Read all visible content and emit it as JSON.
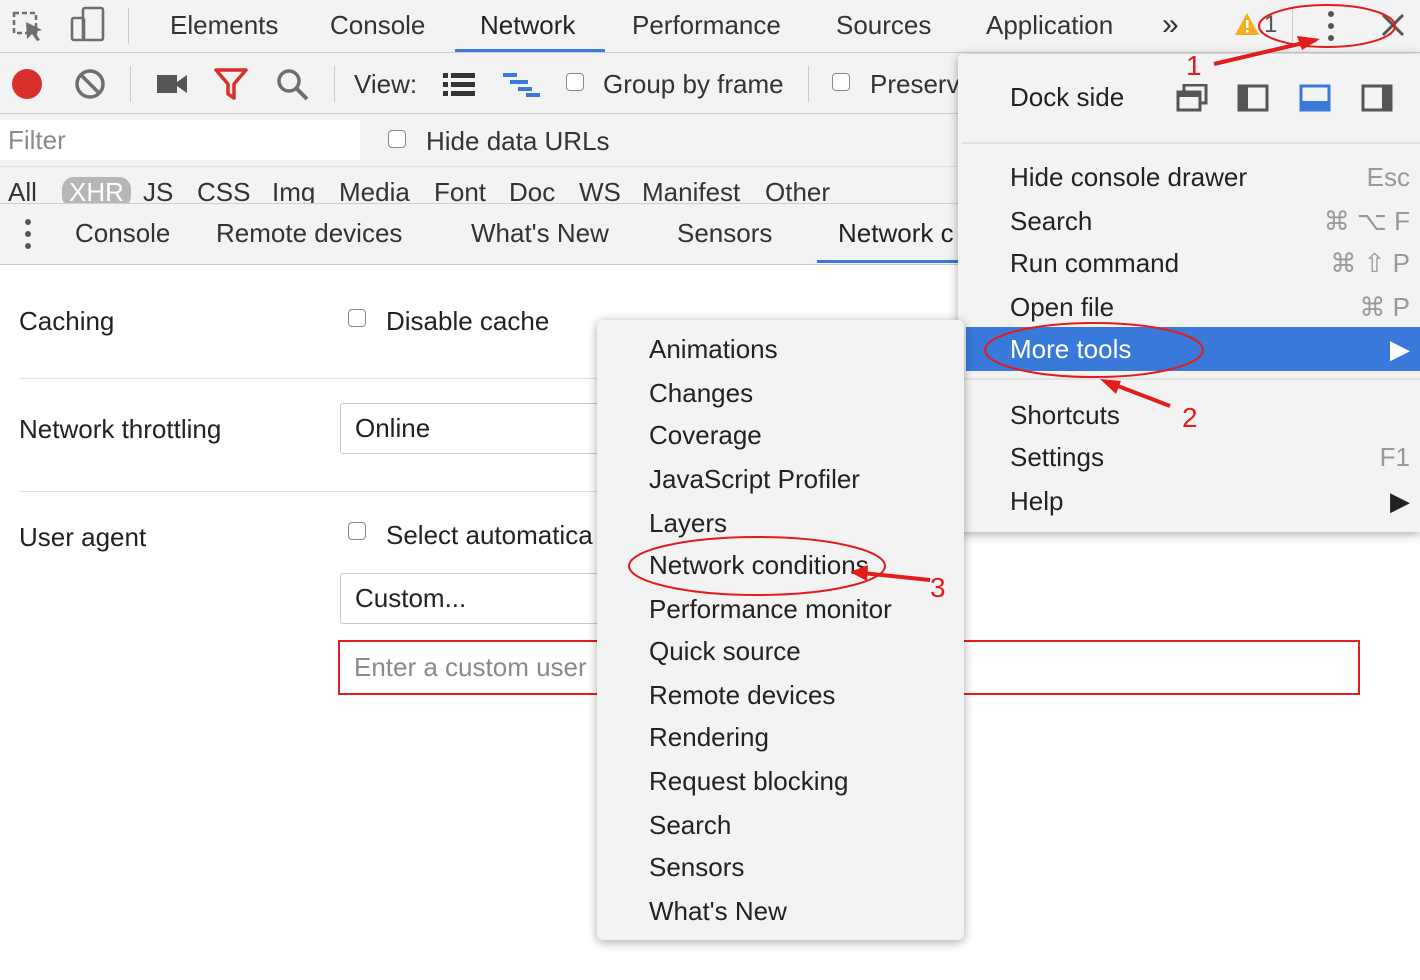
{
  "top_tabs": [
    "Elements",
    "Console",
    "Network",
    "Performance",
    "Sources",
    "Application"
  ],
  "top_overflow": "»",
  "warning_count": "1",
  "toolbar": {
    "view_label": "View:",
    "group_by_frame": "Group by frame",
    "preserve_log": "Preserv"
  },
  "filter": {
    "placeholder": "Filter",
    "hide_data_urls": "Hide data URLs"
  },
  "type_filters": [
    "All",
    "XHR",
    "JS",
    "CSS",
    "Img",
    "Media",
    "Font",
    "Doc",
    "WS",
    "Manifest",
    "Other"
  ],
  "drawer_tabs": [
    "Console",
    "Remote devices",
    "What's New",
    "Sensors",
    "Network c"
  ],
  "panel": {
    "caching_label": "Caching",
    "disable_cache": "Disable cache",
    "throttling_label": "Network throttling",
    "throttling_value": "Online",
    "user_agent_label": "User agent",
    "select_automatically": "Select automatica",
    "ua_select_value": "Custom...",
    "ua_input_placeholder": "Enter a custom user"
  },
  "main_menu": {
    "dock_side": "Dock side",
    "items": [
      {
        "label": "Hide console drawer",
        "shortcut": "Esc"
      },
      {
        "label": "Search",
        "shortcut": "⌘ ⌥ F"
      },
      {
        "label": "Run command",
        "shortcut": "⌘ ⇧ P"
      },
      {
        "label": "Open file",
        "shortcut": "⌘ P"
      },
      {
        "label": "More tools",
        "shortcut": "▶"
      },
      {
        "label": "Shortcuts",
        "shortcut": ""
      },
      {
        "label": "Settings",
        "shortcut": "F1"
      },
      {
        "label": "Help",
        "shortcut": "▶"
      }
    ]
  },
  "more_tools_menu": [
    "Animations",
    "Changes",
    "Coverage",
    "JavaScript Profiler",
    "Layers",
    "Network conditions",
    "Performance monitor",
    "Quick source",
    "Remote devices",
    "Rendering",
    "Request blocking",
    "Search",
    "Sensors",
    "What's New"
  ],
  "annotations": [
    "1",
    "2",
    "3"
  ],
  "colors": {
    "accent": "#3879d9",
    "annotation": "#e31c1c",
    "record": "#d9302c"
  }
}
